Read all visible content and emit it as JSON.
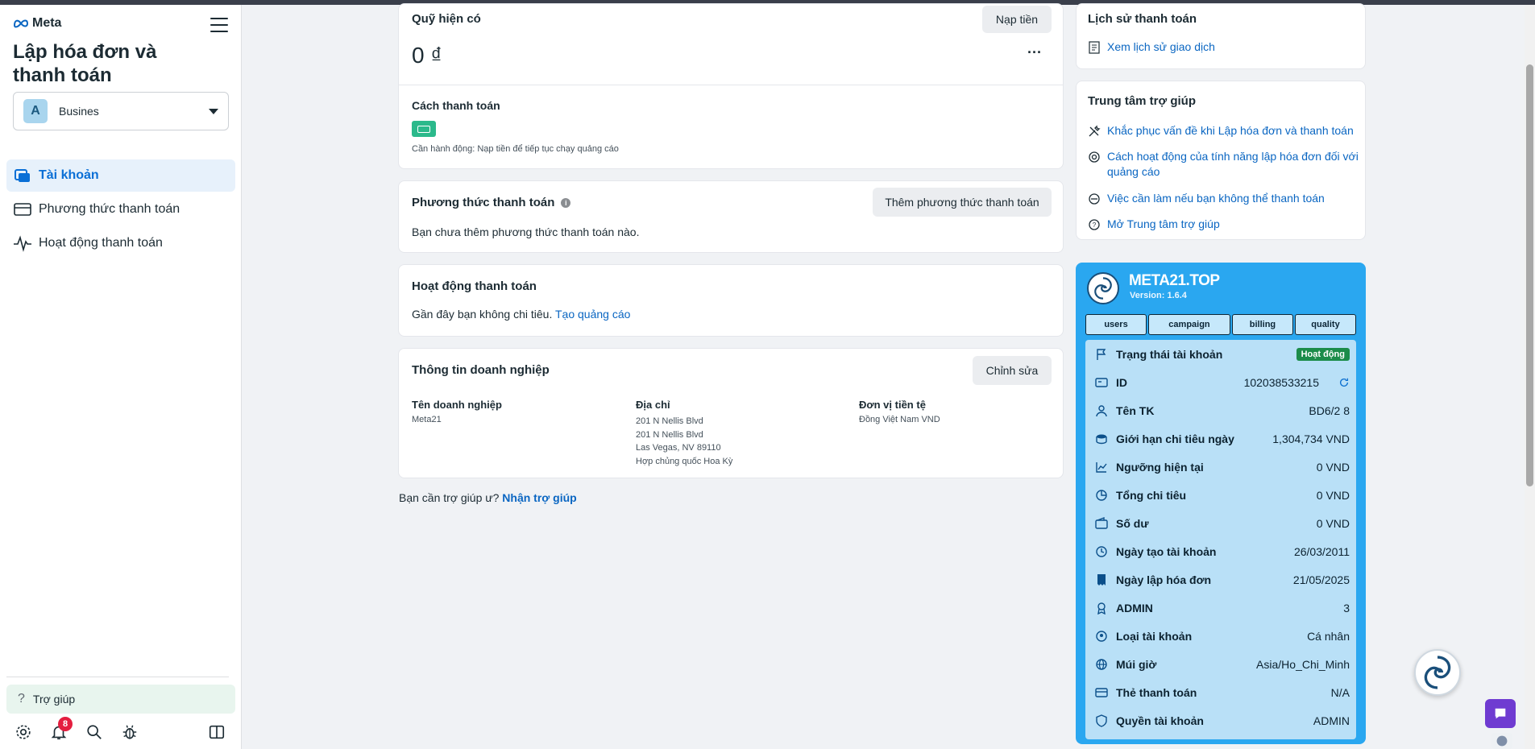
{
  "sidebar": {
    "logo_text": "Meta",
    "title": "Lập hóa đơn và thanh toán",
    "business": {
      "avatar_letter": "A",
      "name": "Busines"
    },
    "nav": [
      {
        "label": "Tài khoản",
        "icon": "account-icon",
        "active": true
      },
      {
        "label": "Phương thức thanh toán",
        "icon": "credit-card-icon",
        "active": false
      },
      {
        "label": "Hoạt động thanh toán",
        "icon": "activity-icon",
        "active": false
      }
    ],
    "help_label": "Trợ giúp",
    "notification_count": "8"
  },
  "funds": {
    "title": "Quỹ hiện có",
    "topup_label": "Nạp tiền",
    "balance": "0 ₫",
    "more_label": "···",
    "payment_label": "Cách thanh toán",
    "action_note": "Cần hành động: Nạp tiền để tiếp tục chạy quảng cáo"
  },
  "payment_methods": {
    "title": "Phương thức thanh toán",
    "add_label": "Thêm phương thức thanh toán",
    "empty_text": "Bạn chưa thêm phương thức thanh toán nào."
  },
  "payment_activity": {
    "title": "Hoạt động thanh toán",
    "text": "Gần đây bạn không chi tiêu.",
    "link": "Tạo quảng cáo"
  },
  "business_info": {
    "title": "Thông tin doanh nghiệp",
    "edit_label": "Chỉnh sửa",
    "name_label": "Tên doanh nghiệp",
    "name_value": "Meta21",
    "address_label": "Địa chỉ",
    "address_lines": [
      "201 N Nellis Blvd",
      "201 N Nellis Blvd",
      "Las Vegas, NV 89110",
      "Hợp chủng quốc Hoa Kỳ"
    ],
    "currency_label": "Đơn vị tiền tệ",
    "currency_value": "Đồng Việt Nam VND"
  },
  "help_prompt": {
    "text": "Bạn cần trợ giúp ư?",
    "link": "Nhận trợ giúp"
  },
  "history": {
    "title": "Lịch sử thanh toán",
    "link": "Xem lịch sử giao dịch"
  },
  "help_center": {
    "title": "Trung tâm trợ giúp",
    "links": [
      "Khắc phục vấn đề khi Lập hóa đơn và thanh toán",
      "Cách hoạt động của tính năng lập hóa đơn đối với quảng cáo",
      "Việc cần làm nếu bạn không thể thanh toán",
      "Mở Trung tâm trợ giúp"
    ]
  },
  "extension": {
    "title": "META21.TOP",
    "version": "Version: 1.6.4",
    "tabs": [
      "users",
      "campaign",
      "billing",
      "quality"
    ],
    "status_label": "Trạng thái tài khoản",
    "status_value": "Hoạt động",
    "rows": [
      {
        "label": "ID",
        "value": "102038533215"
      },
      {
        "label": "Tên TK",
        "value": "BD6/2 8"
      },
      {
        "label": "Giới hạn chi tiêu ngày",
        "value": "1,304,734 VND"
      },
      {
        "label": "Ngưỡng hiện tại",
        "value": "0 VND"
      },
      {
        "label": "Tổng chi tiêu",
        "value": "0 VND"
      },
      {
        "label": "Số dư",
        "value": "0 VND"
      },
      {
        "label": "Ngày tạo tài khoản",
        "value": "26/03/2011"
      },
      {
        "label": "Ngày lập hóa đơn",
        "value": "21/05/2025"
      },
      {
        "label": "ADMIN",
        "value": "3"
      },
      {
        "label": "Loại tài khoản",
        "value": "Cá nhân"
      },
      {
        "label": "Múi giờ",
        "value": "Asia/Ho_Chi_Minh"
      },
      {
        "label": "Thẻ thanh toán",
        "value": "N/A"
      },
      {
        "label": "Quyền tài khoản",
        "value": "ADMIN"
      }
    ]
  },
  "colors": {
    "accent": "#0a66c2",
    "extension_bg": "#2aa7f0",
    "status_green": "#1c8c4a",
    "badge_red": "#e41e3f"
  }
}
